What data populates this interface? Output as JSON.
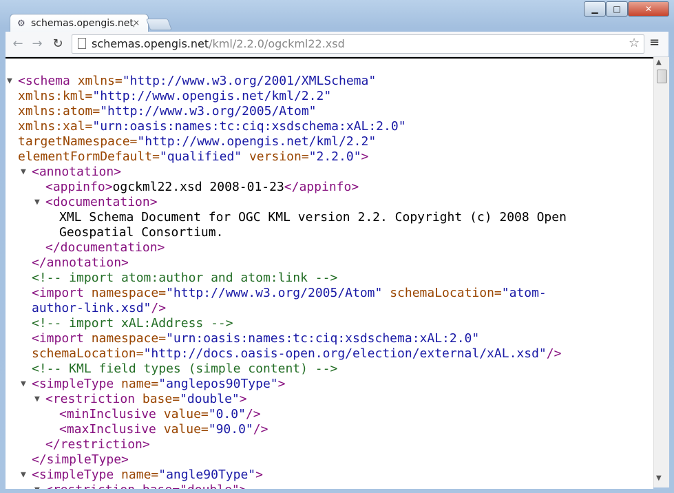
{
  "browser": {
    "tab_title": "schemas.opengis.net/",
    "tab_close": "×",
    "url_host": "schemas.opengis.net",
    "url_path": "/kml/2.2.0/ogckml22.xsd",
    "window_buttons": {
      "minimize": "▁",
      "maximize": "□",
      "close": "✕"
    },
    "icons": [
      "back-arrow-icon",
      "forward-arrow-icon",
      "reload-icon",
      "page-icon",
      "star-icon",
      "menu-icon"
    ]
  },
  "xml": {
    "schema_open": "<schema",
    "xmlns_attr": " xmlns=",
    "xmlns_val": "\"http://www.w3.org/2001/XMLSchema\"",
    "kml_attr": "xmlns:kml=",
    "kml_val": "\"http://www.opengis.net/kml/2.2\"",
    "atom_attr": "xmlns:atom=",
    "atom_val": "\"http://www.w3.org/2005/Atom\"",
    "xal_attr": "xmlns:xal=",
    "xal_val": "\"urn:oasis:names:tc:ciq:xsdschema:xAL:2.0\"",
    "tn_attr": "targetNamespace=",
    "tn_val": "\"http://www.opengis.net/kml/2.2\"",
    "efd_attr": "elementFormDefault=",
    "efd_val": "\"qualified\"",
    "ver_attr": " version=",
    "ver_val": "\"2.2.0\"",
    "close_gt": ">",
    "annotation_open": "<annotation>",
    "appinfo_open": "<appinfo>",
    "appinfo_text": "ogckml22.xsd 2008-01-23",
    "appinfo_close": "</appinfo>",
    "documentation_open": "<documentation>",
    "doc_text_1": "XML Schema Document for OGC KML version 2.2. Copyright (c) 2008 Open",
    "doc_text_2": "Geospatial Consortium.",
    "documentation_close": "</documentation>",
    "annotation_close": "</annotation>",
    "comment_1": "<!-- import atom:author and atom:link -->",
    "import_open": "<import",
    "ns_attr": " namespace=",
    "import1_ns": "\"http://www.w3.org/2005/Atom\"",
    "sl_attr": " schemaLocation=",
    "import1_sl_a": "\"atom-",
    "import1_sl_b": "author-link.xsd\"",
    "self_close": "/>",
    "comment_2": "<!-- import xAL:Address -->",
    "import2_ns": "\"urn:oasis:names:tc:ciq:xsdschema:xAL:2.0\"",
    "sl_attr2": "schemaLocation=",
    "import2_sl": "\"http://docs.oasis-open.org/election/external/xAL.xsd\"",
    "comment_3": "<!-- KML field types (simple content) -->",
    "simpletype_open": "<simpleType",
    "name_attr": " name=",
    "st1_name": "\"anglepos90Type\"",
    "restriction_open": "<restriction",
    "base_attr": " base=",
    "base_val": "\"double\"",
    "mininc_open": "<minInclusive",
    "value_attr": " value=",
    "min_val": "\"0.0\"",
    "maxinc_open": "<maxInclusive",
    "max_val": "\"90.0\"",
    "restriction_close": "</restriction>",
    "simpletype_close": "</simpleType>",
    "st2_name": "\"angle90Type\"",
    "last_partial": "<restriction base=\"double\">"
  },
  "colors": {
    "tag": "#881280",
    "attr": "#994500",
    "value": "#1a1aa6",
    "comment": "#236e25"
  }
}
